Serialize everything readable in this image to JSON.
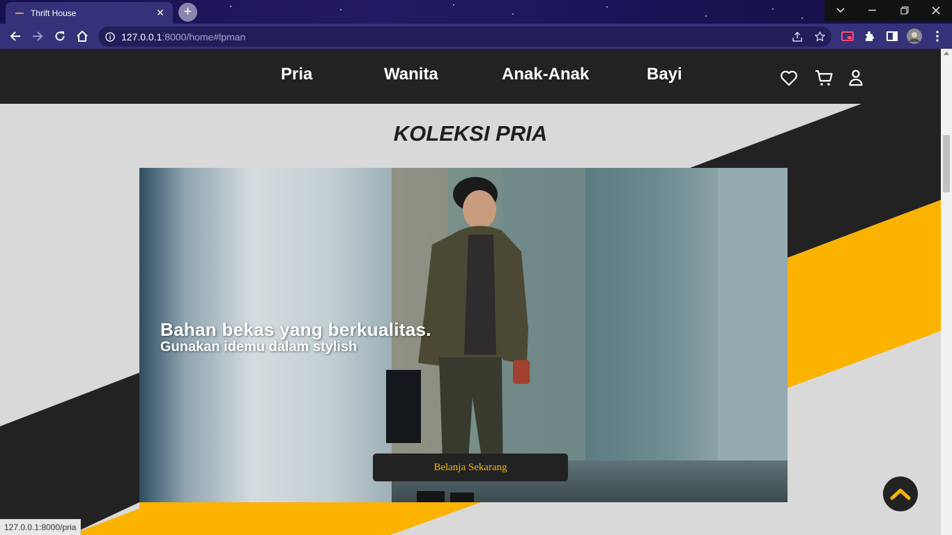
{
  "browser": {
    "tab_title": "Thrift House",
    "new_tab_symbol": "+",
    "url_host": "127.0.0.1",
    "url_path": ":8000/home#lpman",
    "status_url": "127.0.0.1:8000/pria"
  },
  "nav": {
    "links": [
      {
        "label": "Pria"
      },
      {
        "label": "Wanita"
      },
      {
        "label": "Anak-Anak"
      },
      {
        "label": "Bayi"
      }
    ],
    "icons": [
      "heart-icon",
      "cart-icon",
      "user-icon"
    ]
  },
  "section": {
    "title": "KOLEKSI PRIA"
  },
  "hero": {
    "headline": "Bahan bekas yang berkualitas.",
    "subline": "Gunakan idemu dalam stylish",
    "cta_label": "Belanja Sekarang"
  },
  "colors": {
    "dark": "#222222",
    "accent": "#f5b500",
    "background": "#d9d9d9"
  }
}
